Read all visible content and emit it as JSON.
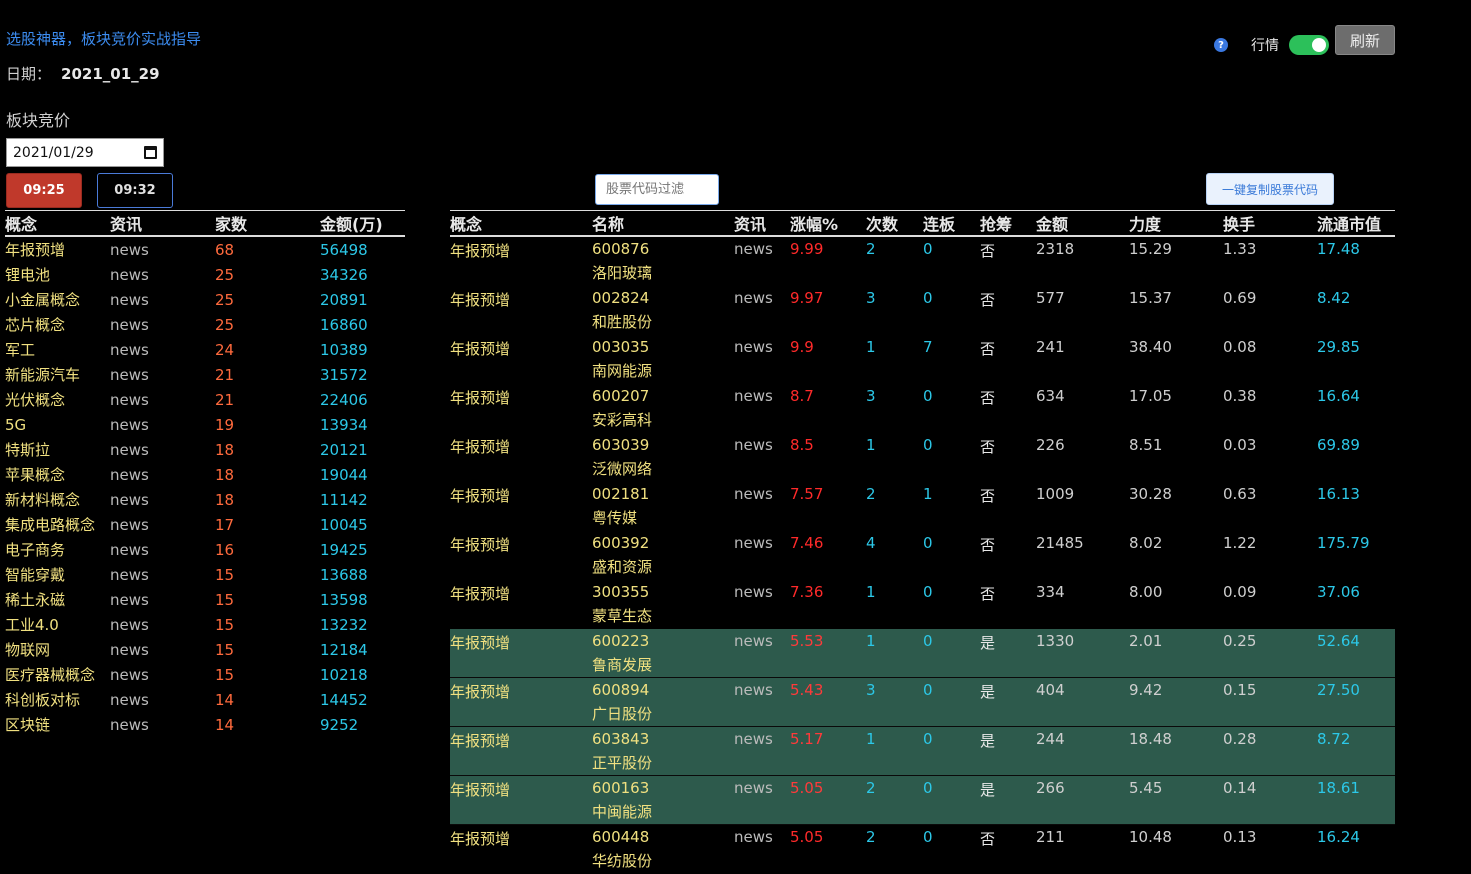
{
  "header": {
    "title": "选股神器，板块竞价实战指导",
    "date_label": "日期：",
    "date_value": "2021_01_29",
    "section_title": "板块竞价",
    "date_input": "2021/01/29",
    "time_buttons": [
      "09:25",
      "09:32"
    ],
    "help_icon": "help-icon",
    "toggle_label": "行情",
    "toggle_on": true,
    "refresh_label": "刷新",
    "filter_placeholder": "股票代码过滤",
    "copy_label": "一键复制股票代码"
  },
  "colors": {
    "accent": "#3c8cf0",
    "active_button": "#c0392b",
    "toggle": "#2cc05a",
    "highlight_row": "#2d5a4c",
    "concept": "#f0e080",
    "count": "#ff6a3d",
    "amount": "#2cc8e8",
    "rise": "#ff2a2a"
  },
  "sectors": {
    "columns": [
      "概念",
      "资讯",
      "家数",
      "金额(万)"
    ],
    "rows": [
      [
        "年报预增",
        "news",
        "68",
        "56498"
      ],
      [
        "锂电池",
        "news",
        "25",
        "34326"
      ],
      [
        "小金属概念",
        "news",
        "25",
        "20891"
      ],
      [
        "芯片概念",
        "news",
        "25",
        "16860"
      ],
      [
        "军工",
        "news",
        "24",
        "10389"
      ],
      [
        "新能源汽车",
        "news",
        "21",
        "31572"
      ],
      [
        "光伏概念",
        "news",
        "21",
        "22406"
      ],
      [
        "5G",
        "news",
        "19",
        "13934"
      ],
      [
        "特斯拉",
        "news",
        "18",
        "20121"
      ],
      [
        "苹果概念",
        "news",
        "18",
        "19044"
      ],
      [
        "新材料概念",
        "news",
        "18",
        "11142"
      ],
      [
        "集成电路概念",
        "news",
        "17",
        "10045"
      ],
      [
        "电子商务",
        "news",
        "16",
        "19425"
      ],
      [
        "智能穿戴",
        "news",
        "15",
        "13688"
      ],
      [
        "稀土永磁",
        "news",
        "15",
        "13598"
      ],
      [
        "工业4.0",
        "news",
        "15",
        "13232"
      ],
      [
        "物联网",
        "news",
        "15",
        "12184"
      ],
      [
        "医疗器械概念",
        "news",
        "15",
        "10218"
      ],
      [
        "科创板对标",
        "news",
        "14",
        "14452"
      ],
      [
        "区块链",
        "news",
        "14",
        "9252"
      ]
    ]
  },
  "stocks": {
    "columns": [
      "概念",
      "名称",
      "资讯",
      "涨幅%",
      "次数",
      "连板",
      "抢筹",
      "金额",
      "力度",
      "换手",
      "流通市值"
    ],
    "rows": [
      {
        "concept": "年报预增",
        "code": "600876",
        "name": "洛阳玻璃",
        "news": "news",
        "rise": "9.99",
        "times": "2",
        "boards": "0",
        "grab": "否",
        "amount": "2318",
        "force": "15.29",
        "turnover": "1.33",
        "cap": "17.48",
        "highlight": false
      },
      {
        "concept": "年报预增",
        "code": "002824",
        "name": "和胜股份",
        "news": "news",
        "rise": "9.97",
        "times": "3",
        "boards": "0",
        "grab": "否",
        "amount": "577",
        "force": "15.37",
        "turnover": "0.69",
        "cap": "8.42",
        "highlight": false
      },
      {
        "concept": "年报预增",
        "code": "003035",
        "name": "南网能源",
        "news": "news",
        "rise": "9.9",
        "times": "1",
        "boards": "7",
        "grab": "否",
        "amount": "241",
        "force": "38.40",
        "turnover": "0.08",
        "cap": "29.85",
        "highlight": false
      },
      {
        "concept": "年报预增",
        "code": "600207",
        "name": "安彩高科",
        "news": "news",
        "rise": "8.7",
        "times": "3",
        "boards": "0",
        "grab": "否",
        "amount": "634",
        "force": "17.05",
        "turnover": "0.38",
        "cap": "16.64",
        "highlight": false
      },
      {
        "concept": "年报预增",
        "code": "603039",
        "name": "泛微网络",
        "news": "news",
        "rise": "8.5",
        "times": "1",
        "boards": "0",
        "grab": "否",
        "amount": "226",
        "force": "8.51",
        "turnover": "0.03",
        "cap": "69.89",
        "highlight": false
      },
      {
        "concept": "年报预增",
        "code": "002181",
        "name": "粤传媒",
        "news": "news",
        "rise": "7.57",
        "times": "2",
        "boards": "1",
        "grab": "否",
        "amount": "1009",
        "force": "30.28",
        "turnover": "0.63",
        "cap": "16.13",
        "highlight": false
      },
      {
        "concept": "年报预增",
        "code": "600392",
        "name": "盛和资源",
        "news": "news",
        "rise": "7.46",
        "times": "4",
        "boards": "0",
        "grab": "否",
        "amount": "21485",
        "force": "8.02",
        "turnover": "1.22",
        "cap": "175.79",
        "highlight": false
      },
      {
        "concept": "年报预增",
        "code": "300355",
        "name": "蒙草生态",
        "news": "news",
        "rise": "7.36",
        "times": "1",
        "boards": "0",
        "grab": "否",
        "amount": "334",
        "force": "8.00",
        "turnover": "0.09",
        "cap": "37.06",
        "highlight": false
      },
      {
        "concept": "年报预增",
        "code": "600223",
        "name": "鲁商发展",
        "news": "news",
        "rise": "5.53",
        "times": "1",
        "boards": "0",
        "grab": "是",
        "amount": "1330",
        "force": "2.01",
        "turnover": "0.25",
        "cap": "52.64",
        "highlight": true
      },
      {
        "concept": "年报预增",
        "code": "600894",
        "name": "广日股份",
        "news": "news",
        "rise": "5.43",
        "times": "3",
        "boards": "0",
        "grab": "是",
        "amount": "404",
        "force": "9.42",
        "turnover": "0.15",
        "cap": "27.50",
        "highlight": true
      },
      {
        "concept": "年报预增",
        "code": "603843",
        "name": "正平股份",
        "news": "news",
        "rise": "5.17",
        "times": "1",
        "boards": "0",
        "grab": "是",
        "amount": "244",
        "force": "18.48",
        "turnover": "0.28",
        "cap": "8.72",
        "highlight": true
      },
      {
        "concept": "年报预增",
        "code": "600163",
        "name": "中闽能源",
        "news": "news",
        "rise": "5.05",
        "times": "2",
        "boards": "0",
        "grab": "是",
        "amount": "266",
        "force": "5.45",
        "turnover": "0.14",
        "cap": "18.61",
        "highlight": true
      },
      {
        "concept": "年报预增",
        "code": "600448",
        "name": "华纺股份",
        "news": "news",
        "rise": "5.05",
        "times": "2",
        "boards": "0",
        "grab": "否",
        "amount": "211",
        "force": "10.48",
        "turnover": "0.13",
        "cap": "16.24",
        "highlight": false
      }
    ]
  }
}
